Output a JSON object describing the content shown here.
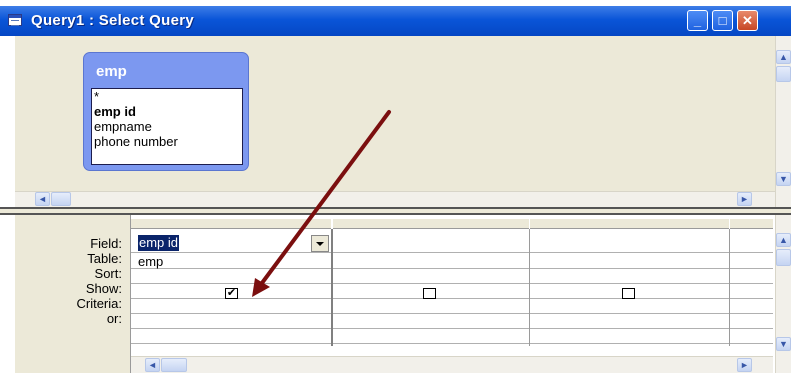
{
  "window": {
    "title": "Query1 : Select Query",
    "minimize_glyph": "_",
    "maximize_glyph": "□",
    "close_glyph": "✕"
  },
  "table": {
    "name": "emp",
    "fields": [
      "*",
      "emp id",
      "empname",
      "phone number"
    ]
  },
  "grid": {
    "row_labels": [
      "Field:",
      "Table:",
      "Sort:",
      "Show:",
      "Criteria:",
      "or:"
    ],
    "columns": [
      {
        "field": "emp id",
        "table": "emp",
        "show": true
      },
      {
        "field": "",
        "table": "",
        "show": false
      },
      {
        "field": "",
        "table": "",
        "show": false
      }
    ]
  },
  "icons": {
    "scroll_left": "◄",
    "scroll_right": "►",
    "scroll_up": "▲",
    "scroll_down": "▼",
    "check": "✔"
  },
  "colors": {
    "titlebar": "#0a55d8",
    "table_header": "#7c98f0",
    "arrow": "#7b0f0f"
  }
}
